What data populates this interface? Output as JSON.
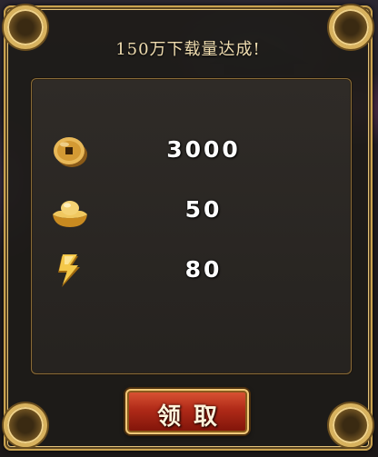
{
  "dialog": {
    "title": "150万下载量达成!"
  },
  "rewards": [
    {
      "icon": "copper-coin-icon",
      "value": "3000"
    },
    {
      "icon": "gold-ingot-icon",
      "value": "50"
    },
    {
      "icon": "lightning-energy-icon",
      "value": "80"
    }
  ],
  "claim_button": {
    "label": "领取"
  },
  "colors": {
    "frame_gold": "#c9a24f",
    "button_red": "#b02a18",
    "title_text": "#f0ddb0"
  }
}
